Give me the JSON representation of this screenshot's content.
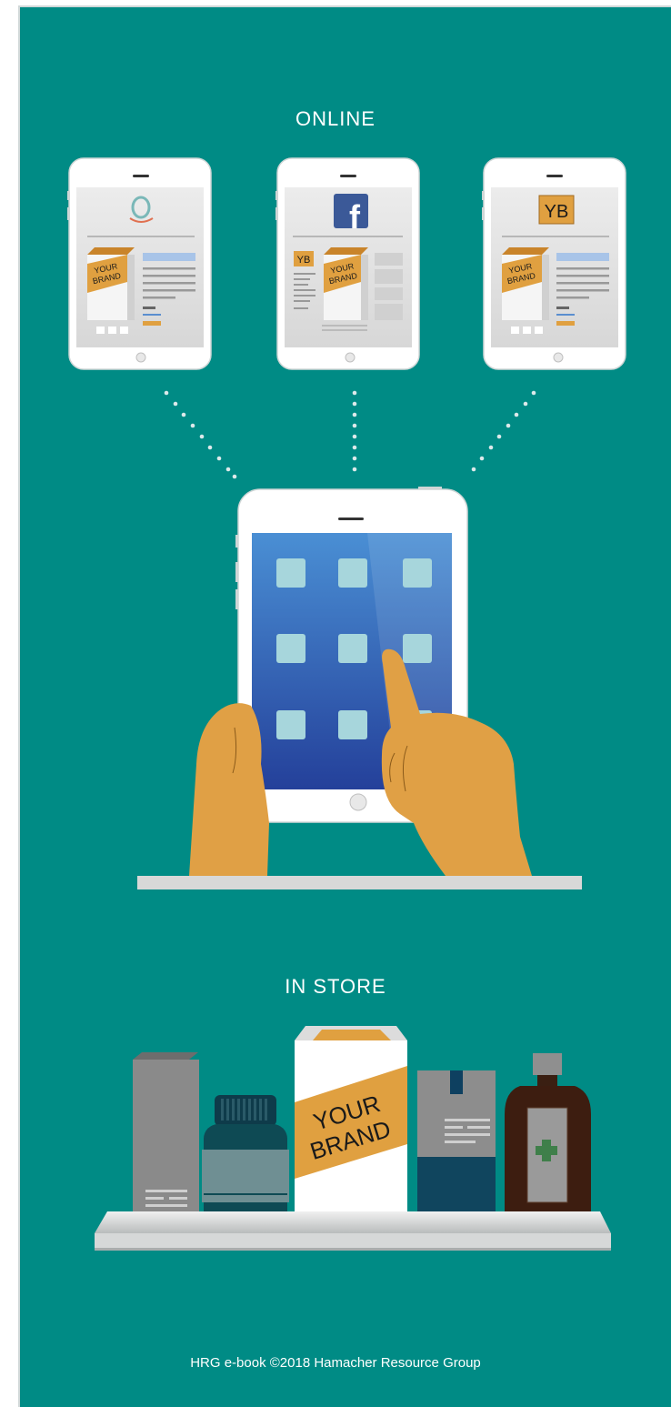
{
  "sections": {
    "online_label": "ONLINE",
    "store_label": "IN STORE"
  },
  "phones": [
    {
      "logo": "amazon-logo",
      "brand_line1": "YOUR",
      "brand_line2": "BRAND"
    },
    {
      "logo": "facebook-logo",
      "logo_text": "f",
      "side_badge": "YB",
      "brand_line1": "YOUR",
      "brand_line2": "BRAND"
    },
    {
      "logo": "yb-logo",
      "logo_text": "YB",
      "brand_line1": "YOUR",
      "brand_line2": "BRAND"
    }
  ],
  "store_box": {
    "line1": "YOUR",
    "line2": "BRAND"
  },
  "footer": "HRG e-book ©2018 Hamacher Resource Group",
  "colors": {
    "background": "#008b85",
    "brand_orange": "#e0a040",
    "phone_white": "#ffffff",
    "screen_blue": "#2a5fa8",
    "shelf_gray": "#d8d8d8"
  }
}
